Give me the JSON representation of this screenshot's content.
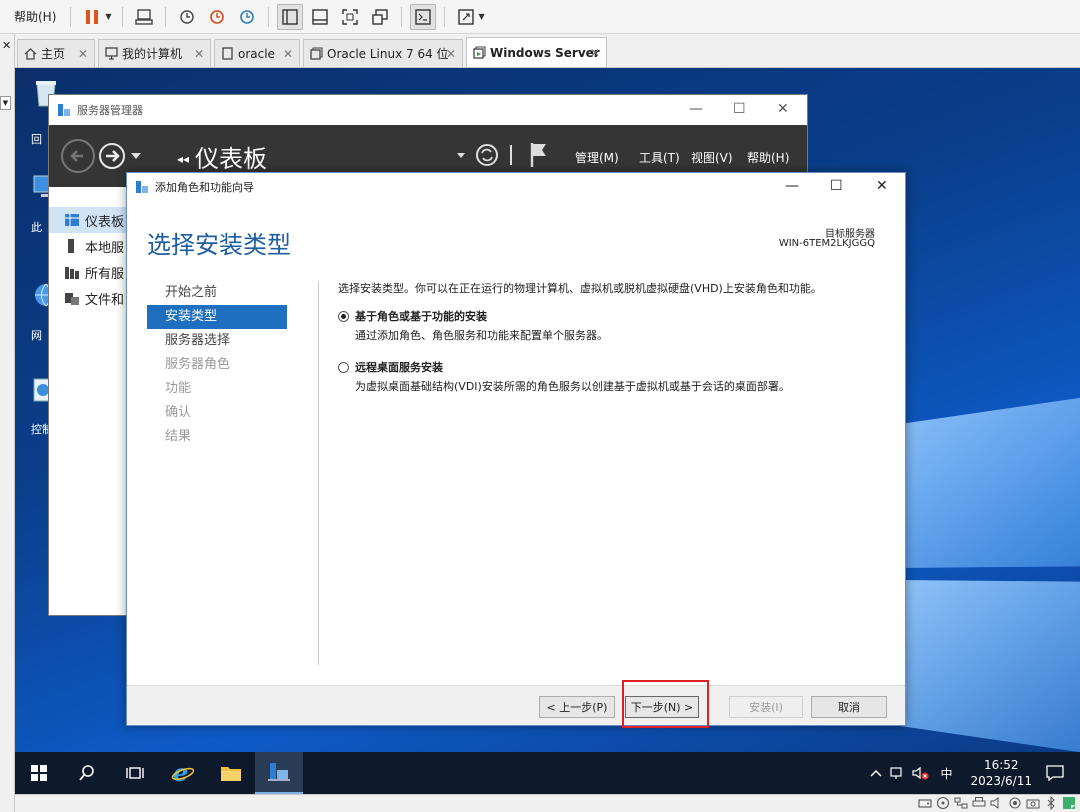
{
  "vm_toolbar": {
    "help_menu": "帮助(H)"
  },
  "tabs": [
    {
      "label": "主页",
      "icon": "home-icon"
    },
    {
      "label": "我的计算机",
      "icon": "computer-icon"
    },
    {
      "label": "oracle",
      "icon": "vm-icon"
    },
    {
      "label": "Oracle Linux 7 64 位",
      "icon": "vm-icon"
    },
    {
      "label": "Windows Server",
      "icon": "vm-running-icon",
      "active": true
    }
  ],
  "desktop_icons": [
    {
      "label": "回",
      "icon": "recycle-bin-icon"
    },
    {
      "label": "此",
      "icon": "this-pc-icon"
    },
    {
      "label": "网",
      "icon": "network-icon"
    },
    {
      "label": "控制",
      "icon": "control-panel-icon"
    }
  ],
  "server_manager": {
    "window_title": "服务器管理器",
    "page_title": "仪表板",
    "title_prefix": "◂◂",
    "menus": [
      "管理(M)",
      "工具(T)",
      "视图(V)",
      "帮助(H)"
    ],
    "sidebar": [
      {
        "label": "仪表板",
        "selected": true
      },
      {
        "label": "本地服"
      },
      {
        "label": "所有服"
      },
      {
        "label": "文件和"
      }
    ]
  },
  "wizard": {
    "window_title": "添加角色和功能向导",
    "heading": "选择安装类型",
    "target_label": "目标服务器",
    "target_name": "WIN-6TEM2LKJGGQ",
    "steps": [
      {
        "label": "开始之前",
        "state": "done"
      },
      {
        "label": "安装类型",
        "state": "current"
      },
      {
        "label": "服务器选择",
        "state": "done"
      },
      {
        "label": "服务器角色",
        "state": "pending"
      },
      {
        "label": "功能",
        "state": "pending"
      },
      {
        "label": "确认",
        "state": "pending"
      },
      {
        "label": "结果",
        "state": "pending"
      }
    ],
    "intro": "选择安装类型。你可以在正在运行的物理计算机、虚拟机或脱机虚拟硬盘(VHD)上安装角色和功能。",
    "options": [
      {
        "title": "基于角色或基于功能的安装",
        "desc": "通过添加角色、角色服务和功能来配置单个服务器。",
        "checked": true
      },
      {
        "title": "远程桌面服务安装",
        "desc": "为虚拟桌面基础结构(VDI)安装所需的角色服务以创建基于虚拟机或基于会话的桌面部署。",
        "checked": false
      }
    ],
    "buttons": {
      "prev": "< 上一步(P)",
      "next": "下一步(N) >",
      "install": "安装(I)",
      "cancel": "取消"
    }
  },
  "taskbar": {
    "ime": "中",
    "time": "16:52",
    "date": "2023/6/11"
  },
  "colors": {
    "accent": "#1e6fbf",
    "heading": "#1e5d9e",
    "highlight": "#e02020"
  }
}
